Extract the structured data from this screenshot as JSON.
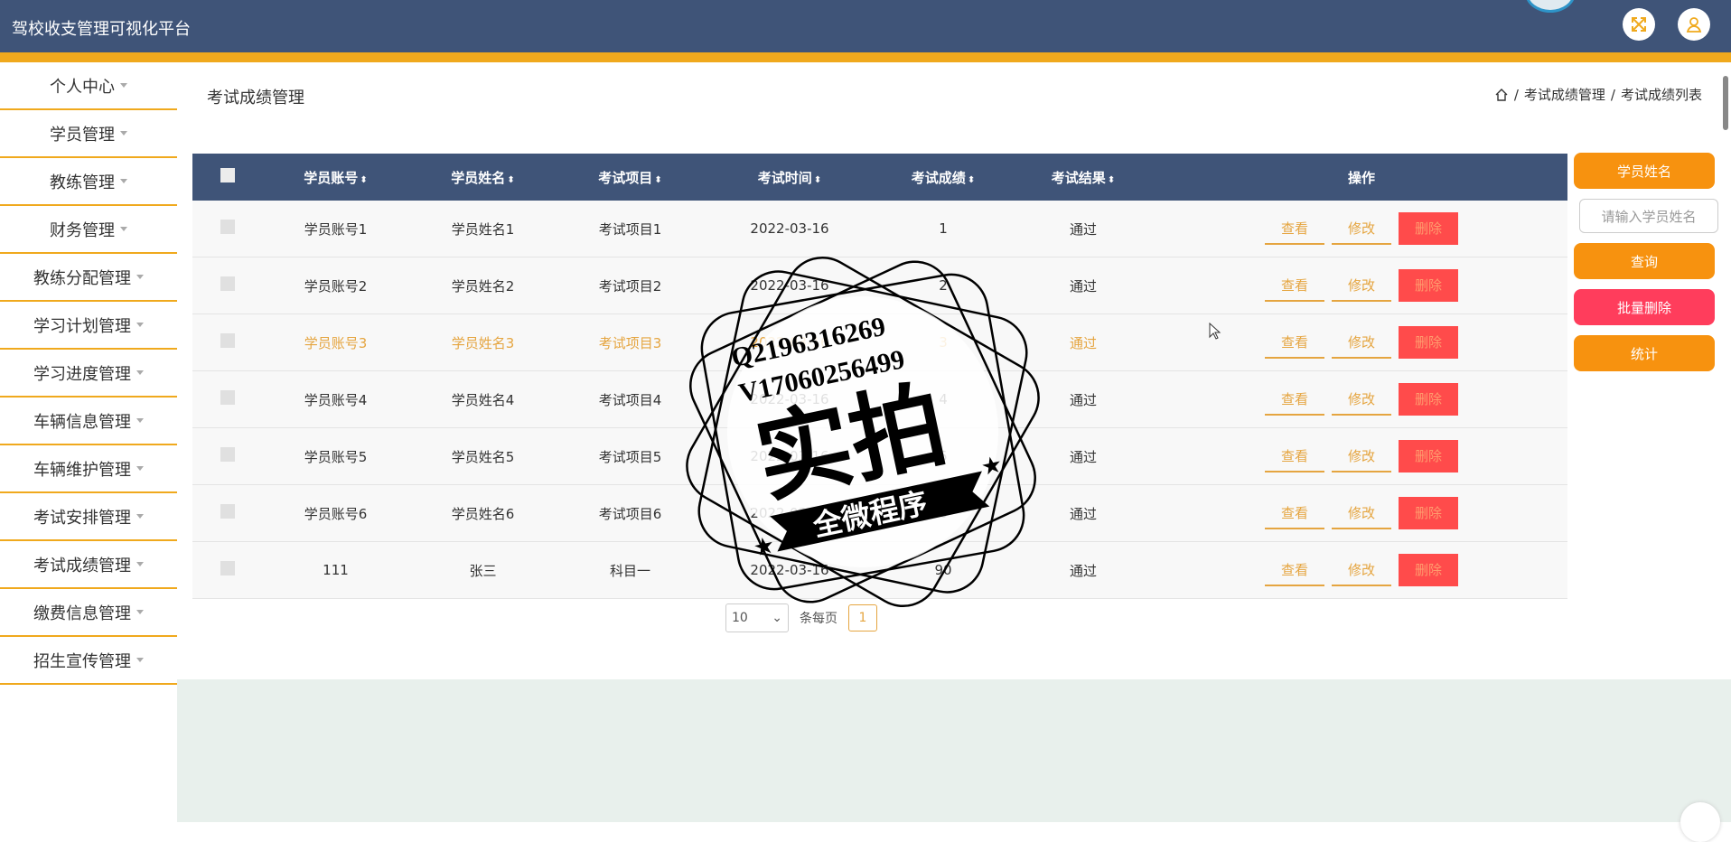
{
  "app": {
    "title": "驾校收支管理可视化平台"
  },
  "header": {
    "fullscreen_icon": "fullscreen-icon",
    "user_icon": "user-icon"
  },
  "sidebar": {
    "items": [
      {
        "label": "个人中心"
      },
      {
        "label": "学员管理"
      },
      {
        "label": "教练管理"
      },
      {
        "label": "财务管理"
      },
      {
        "label": "教练分配管理"
      },
      {
        "label": "学习计划管理"
      },
      {
        "label": "学习进度管理"
      },
      {
        "label": "车辆信息管理"
      },
      {
        "label": "车辆维护管理"
      },
      {
        "label": "考试安排管理"
      },
      {
        "label": "考试成绩管理"
      },
      {
        "label": "缴费信息管理"
      },
      {
        "label": "招生宣传管理"
      }
    ]
  },
  "page": {
    "title": "考试成绩管理",
    "breadcrumb": {
      "sep": "/",
      "level1": "考试成绩管理",
      "level2": "考试成绩列表"
    }
  },
  "table": {
    "headers": {
      "account": "学员账号",
      "name": "学员姓名",
      "project": "考试项目",
      "time": "考试时间",
      "score": "考试成绩",
      "result": "考试结果",
      "ops": "操作"
    },
    "rows": [
      {
        "account": "学员账号1",
        "name": "学员姓名1",
        "project": "考试项目1",
        "time": "2022-03-16",
        "score": "1",
        "result": "通过"
      },
      {
        "account": "学员账号2",
        "name": "学员姓名2",
        "project": "考试项目2",
        "time": "2022-03-16",
        "score": "2",
        "result": "通过"
      },
      {
        "account": "学员账号3",
        "name": "学员姓名3",
        "project": "考试项目3",
        "time": "2022-03-16",
        "score": "3",
        "result": "通过"
      },
      {
        "account": "学员账号4",
        "name": "学员姓名4",
        "project": "考试项目4",
        "time": "2022-03-16",
        "score": "4",
        "result": "通过"
      },
      {
        "account": "学员账号5",
        "name": "学员姓名5",
        "project": "考试项目5",
        "time": "2022-03-16",
        "score": "5",
        "result": "通过"
      },
      {
        "account": "学员账号6",
        "name": "学员姓名6",
        "project": "考试项目6",
        "time": "2022-03-16",
        "score": "6",
        "result": "通过"
      },
      {
        "account": "111",
        "name": "张三",
        "project": "科目一",
        "time": "2022-03-16",
        "score": "90",
        "result": "通过"
      }
    ],
    "actions": {
      "view": "查看",
      "edit": "修改",
      "delete": "删除"
    }
  },
  "pager": {
    "page_size": "10",
    "per_page_label": "条每页",
    "current_page": "1"
  },
  "search": {
    "field_label": "学员姓名",
    "placeholder": "请输入学员姓名",
    "query_button": "查询",
    "batch_delete_button": "批量删除",
    "stats_button": "统计"
  },
  "watermark": {
    "line1": "Q2196316269",
    "line2": "V17060256499",
    "big": "实拍",
    "banner": "全微程序"
  },
  "colors": {
    "header": "#3f5478",
    "accent": "#f0a91d",
    "orange": "#f7920f",
    "red": "#ff3d5c"
  }
}
